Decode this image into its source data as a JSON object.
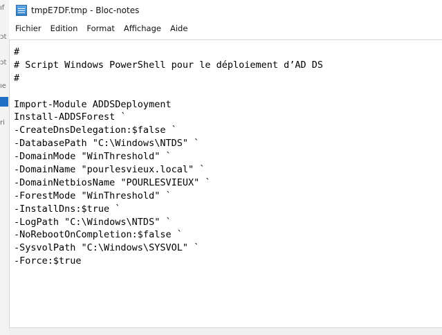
{
  "window": {
    "title": "tmpE7DF.tmp - Bloc-notes",
    "icon": "notepad-icon"
  },
  "menu": [
    {
      "label": "Fichier"
    },
    {
      "label": "Edition"
    },
    {
      "label": "Format"
    },
    {
      "label": "Affichage"
    },
    {
      "label": "Aide"
    }
  ],
  "editor": {
    "lines": [
      "#",
      "# Script Windows PowerShell pour le déploiement d’AD DS",
      "#",
      "",
      "Import-Module ADDSDeployment",
      "Install-ADDSForest `",
      "-CreateDnsDelegation:$false `",
      "-DatabasePath \"C:\\Windows\\NTDS\" `",
      "-DomainMode \"WinThreshold\" `",
      "-DomainName \"pourlesvieux.local\" `",
      "-DomainNetbiosName \"POURLESVIEUX\" `",
      "-ForestMode \"WinThreshold\" `",
      "-InstallDns:$true `",
      "-LogPath \"C:\\Windows\\NTDS\" `",
      "-NoRebootOnCompletion:$false `",
      "-SysvolPath \"C:\\Windows\\SYSVOL\" `",
      "-Force:$true"
    ]
  },
  "background_fragments": [
    "ıf",
    "ɔt",
    "ɔt",
    "ıe",
    "ri"
  ]
}
